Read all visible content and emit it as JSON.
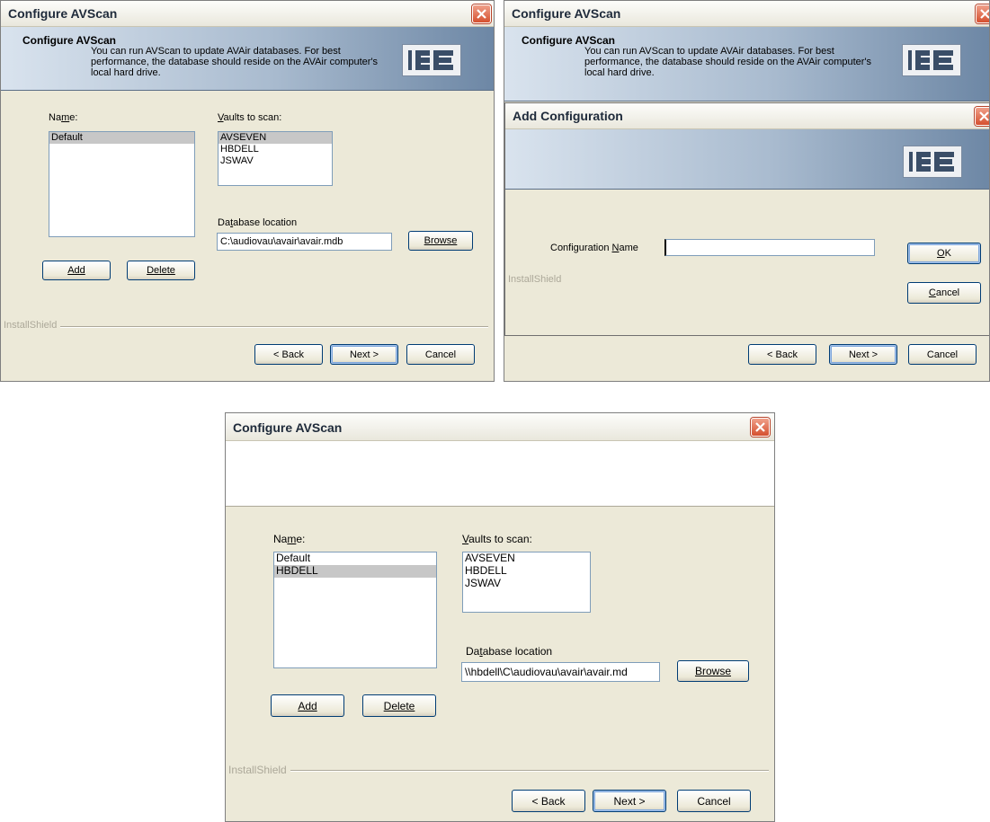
{
  "win1": {
    "title": "Configure AVScan",
    "banner_title": "Configure AVScan",
    "banner_desc": "You can run AVScan to update AVAir databases. For best performance, the database should reside on the AVAir computer's local hard drive.",
    "logo_icon": "ibe-logo-icon",
    "name_label_pre": "Na",
    "name_label_acc": "m",
    "name_label_post": "e:",
    "names": [
      "Default"
    ],
    "vaults_label_acc": "V",
    "vaults_label_post": "aults to scan:",
    "vaults": [
      "AVSEVEN",
      "HBDELL",
      "JSWAV"
    ],
    "db_label_pre": "Da",
    "db_label_acc": "t",
    "db_label_post": "abase location",
    "db_value": "C:\\audiovau\\avair\\avair.mdb",
    "browse": "Browse",
    "add": "Add",
    "delete": "Delete",
    "installshield": "InstallShield",
    "back": "< Back",
    "next": "Next >",
    "cancel": "Cancel"
  },
  "win2": {
    "title": "Configure AVScan",
    "banner_title": "Configure AVScan",
    "banner_desc": "You can run AVScan to update AVAir databases. For best performance, the database should reside on the AVAir computer's local hard drive.",
    "logo_icon": "ibe-logo-icon",
    "back": "< Back",
    "next": "Next >",
    "cancel": "Cancel"
  },
  "dialog": {
    "title": "Add Configuration",
    "logo_icon": "ibe-logo-icon",
    "config_label_pre": "Configuration ",
    "config_label_acc": "N",
    "config_label_post": "ame",
    "config_value": "",
    "installshield": "InstallShield",
    "ok_acc": "O",
    "ok_post": "K",
    "cancel_acc": "C",
    "cancel_post": "ancel"
  },
  "win3": {
    "title": "Configure AVScan",
    "name_label_pre": "Na",
    "name_label_acc": "m",
    "name_label_post": "e:",
    "names": [
      "Default",
      "HBDELL"
    ],
    "vaults_label_acc": "V",
    "vaults_label_post": "aults to scan:",
    "vaults": [
      "AVSEVEN",
      "HBDELL",
      "JSWAV"
    ],
    "db_label_pre": "Da",
    "db_label_acc": "t",
    "db_label_post": "abase location",
    "db_value": "\\\\hbdell\\C\\audiovau\\avair\\avair.md",
    "browse": "Browse",
    "add": "Add",
    "delete": "Delete",
    "installshield": "InstallShield",
    "back": "< Back",
    "next": "Next >",
    "cancel": "Cancel"
  },
  "colors": {
    "window_bg": "#ece9d8",
    "banner_dark": "#6d87a5",
    "close_red": "#d5502f",
    "selection": "#c7c7c7"
  }
}
